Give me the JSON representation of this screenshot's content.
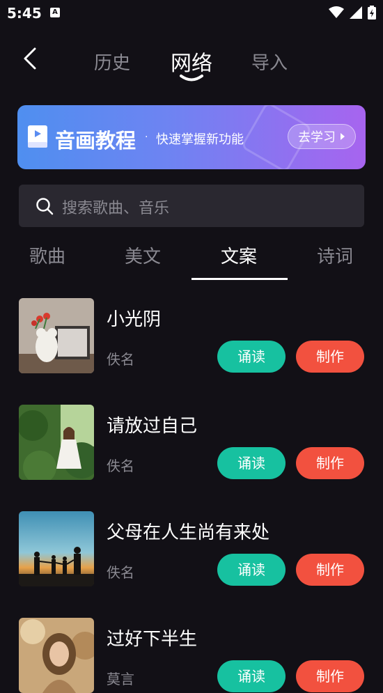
{
  "status": {
    "time": "5:45",
    "a_badge": "A"
  },
  "nav": {
    "tabs": [
      "历史",
      "网络",
      "导入"
    ],
    "active": "网络"
  },
  "banner": {
    "title": "音画教程",
    "dot": "·",
    "subtitle": "快速掌握新功能",
    "button": "去学习",
    "colors": {
      "start": "#4f8ff0",
      "end": "#a764ef"
    }
  },
  "search": {
    "placeholder": "搜索歌曲、音乐"
  },
  "categories": {
    "tabs": [
      "歌曲",
      "美文",
      "文案",
      "诗词"
    ],
    "active": "文案"
  },
  "items": [
    {
      "title": "小光阴",
      "author": "佚名",
      "read_label": "诵读",
      "make_label": "制作"
    },
    {
      "title": "请放过自己",
      "author": "佚名",
      "read_label": "诵读",
      "make_label": "制作"
    },
    {
      "title": "父母在人生尚有来处",
      "author": "佚名",
      "read_label": "诵读",
      "make_label": "制作"
    },
    {
      "title": "过好下半生",
      "author": "莫言",
      "read_label": "诵读",
      "make_label": "制作"
    }
  ],
  "colors": {
    "read": "#17c1a0",
    "make": "#f2513f",
    "background": "#121016"
  }
}
